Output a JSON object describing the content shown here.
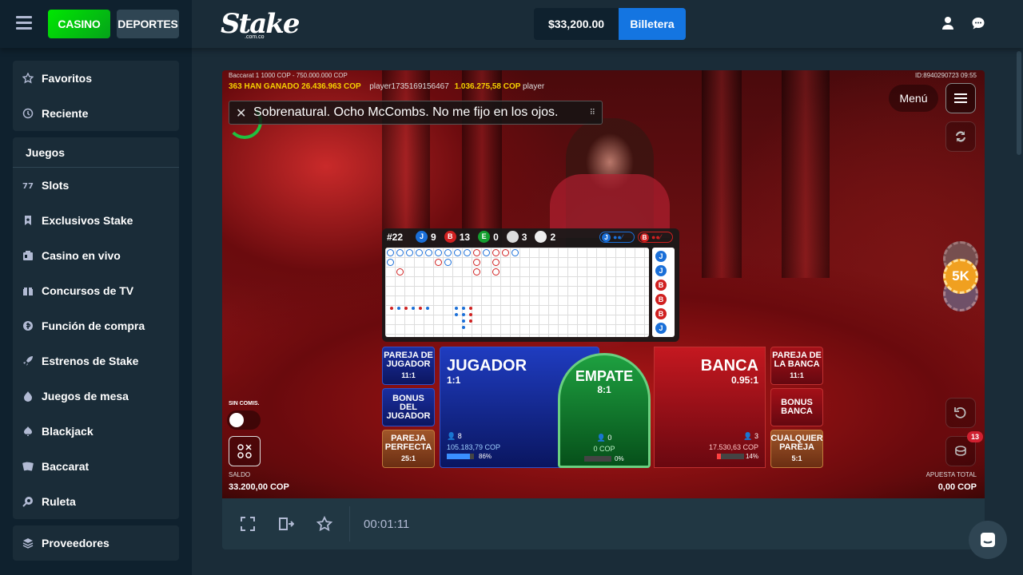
{
  "header": {
    "tab_casino": "CASINO",
    "tab_sports": "DEPORTES",
    "logo": "Stake",
    "logo_sub": ".com.co",
    "balance": "$33,200.00",
    "wallet_label": "Billetera"
  },
  "sidebar": {
    "top_items": [
      {
        "label": "Favoritos",
        "icon": "star-icon"
      },
      {
        "label": "Reciente",
        "icon": "history-icon"
      }
    ],
    "games_header": "Juegos",
    "game_items": [
      {
        "label": "Slots",
        "icon": "slots-icon"
      },
      {
        "label": "Exclusivos Stake",
        "icon": "bookmark-icon"
      },
      {
        "label": "Casino en vivo",
        "icon": "live-casino-icon"
      },
      {
        "label": "Concursos de TV",
        "icon": "tv-game-icon"
      },
      {
        "label": "Función de compra",
        "icon": "buy-feature-icon"
      },
      {
        "label": "Estrenos de Stake",
        "icon": "rocket-icon"
      },
      {
        "label": "Juegos de mesa",
        "icon": "table-games-icon"
      },
      {
        "label": "Blackjack",
        "icon": "blackjack-icon"
      },
      {
        "label": "Baccarat",
        "icon": "baccarat-icon"
      },
      {
        "label": "Ruleta",
        "icon": "roulette-icon"
      }
    ],
    "providers": "Proveedores"
  },
  "game": {
    "table_info": "Baccarat 1  1000 COP - 750.000.000 COP",
    "winners_count": "363",
    "winners_label": "HAN GANADO",
    "winners_amount": "26.436.963 COP",
    "player_name": "player1735169156467",
    "player_amount": "1.036.275,58 COP",
    "player_next": "player",
    "game_id": "ID:8940290723 09:55",
    "subtitle": "Sobrenatural. Ocho McCombs. No me fijo en los ojos.",
    "menu_label": "Menú",
    "sin_comis": "SIN COMIS.",
    "saldo_label": "SALDO",
    "saldo_value": "33.200,00 COP",
    "apuesta_label": "APUESTA TOTAL",
    "apuesta_value": "0,00 COP",
    "chip_value": "5K",
    "notif_count": "13",
    "roadmap": {
      "round": "#22",
      "player_count": "9",
      "banker_count": "13",
      "tie_count": "0",
      "ppair_count": "3",
      "bpair_count": "2",
      "j": "J",
      "b": "B",
      "e": "E",
      "side_column": [
        "J",
        "J",
        "B",
        "B",
        "B",
        "J"
      ]
    },
    "bets": {
      "player_pair": {
        "title": "PAREJA DE JUGADOR",
        "odds": "11:1"
      },
      "player_bonus": {
        "title": "BONUS DEL JUGADOR"
      },
      "perfect_pair": {
        "title": "PAREJA PERFECTA",
        "odds": "25:1"
      },
      "player": {
        "title": "JUGADOR",
        "odds": "1:1",
        "bettors": "8",
        "amount": "105.183,79 COP",
        "percent": "86%",
        "fill": 0.86
      },
      "tie": {
        "title": "EMPATE",
        "odds": "8:1",
        "bettors": "0",
        "amount": "0 COP",
        "percent": "0%",
        "fill": 0
      },
      "banker": {
        "title": "BANCA",
        "odds": "0.95:1",
        "bettors": "3",
        "amount": "17.530,63 COP",
        "percent": "14%",
        "fill": 0.14
      },
      "banker_pair": {
        "title": "PAREJA DE LA BANCA",
        "odds": "11:1"
      },
      "banker_bonus": {
        "title": "BONUS BANCA"
      },
      "either_pair": {
        "title": "CUALQUIER PAREJA",
        "odds": "5:1"
      }
    }
  },
  "bottom": {
    "timer": "00:01:11"
  },
  "colors": {
    "accent_green": "#00e701",
    "wallet_blue": "#1475e1",
    "sidebar_bg": "#0f212e",
    "app_bg": "#1a2c38"
  }
}
